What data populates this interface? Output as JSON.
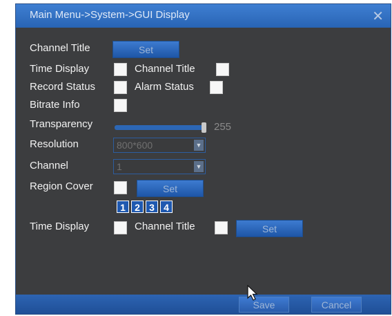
{
  "window": {
    "title": "Main Menu->System->GUI Display",
    "close_icon": "close-icon"
  },
  "form": {
    "channel_title_label": "Channel Title",
    "channel_title_set": "Set",
    "time_display_label": "Time Display",
    "channel_title_check_label": "Channel Title",
    "record_status_label": "Record Status",
    "alarm_status_label": "Alarm Status",
    "bitrate_info_label": "Bitrate Info",
    "transparency_label": "Transparency",
    "transparency_value": "255",
    "resolution_label": "Resolution",
    "resolution_value": "800*600",
    "channel_label": "Channel",
    "channel_value": "1",
    "region_cover_label": "Region Cover",
    "region_cover_set": "Set",
    "regions": [
      "1",
      "2",
      "3",
      "4"
    ],
    "time_display2_label": "Time Display",
    "channel_title2_label": "Channel Title",
    "overlay_set": "Set"
  },
  "footer": {
    "save_label": "Save",
    "cancel_label": "Cancel"
  }
}
